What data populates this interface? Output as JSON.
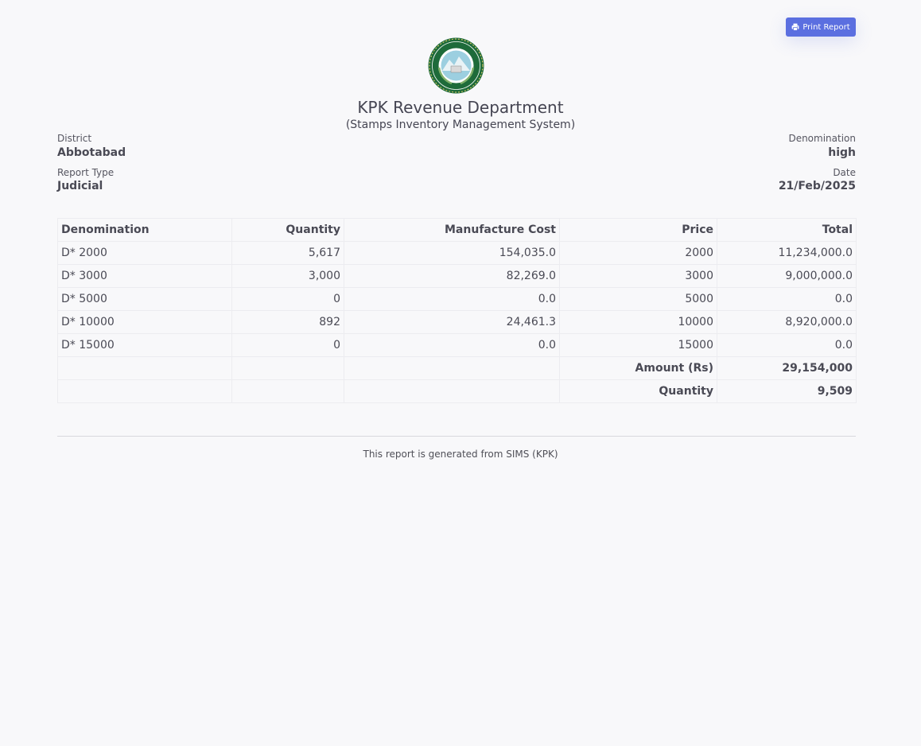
{
  "toolbar": {
    "print_label": "Print Report",
    "print_icon": "printer-icon",
    "accent_color": "#5b6fe0"
  },
  "header": {
    "logo_icon": "kpk-seal-logo",
    "title": "KPK Revenue Department",
    "subtitle": "(Stamps Inventory Management System)"
  },
  "meta": {
    "district_label": "District",
    "district_value": "Abbotabad",
    "report_type_label": "Report Type",
    "report_type_value": "Judicial",
    "denomination_label": "Denomination",
    "denomination_value": "high",
    "date_label": "Date",
    "date_value": "21/Feb/2025"
  },
  "table": {
    "columns": [
      "Denomination",
      "Quantity",
      "Manufacture Cost",
      "Price",
      "Total"
    ],
    "rows": [
      [
        "D* 2000",
        "5,617",
        "154,035.0",
        "2000",
        "11,234,000.0"
      ],
      [
        "D* 3000",
        "3,000",
        "82,269.0",
        "3000",
        "9,000,000.0"
      ],
      [
        "D* 5000",
        "0",
        "0.0",
        "5000",
        "0.0"
      ],
      [
        "D* 10000",
        "892",
        "24,461.3",
        "10000",
        "8,920,000.0"
      ],
      [
        "D* 15000",
        "0",
        "0.0",
        "15000",
        "0.0"
      ]
    ],
    "summary": {
      "amount_label": "Amount (Rs)",
      "amount_value": "29,154,000",
      "quantity_label": "Quantity",
      "quantity_value": "9,509"
    }
  },
  "footer": {
    "note": "This report is generated from SIMS (KPK)"
  }
}
